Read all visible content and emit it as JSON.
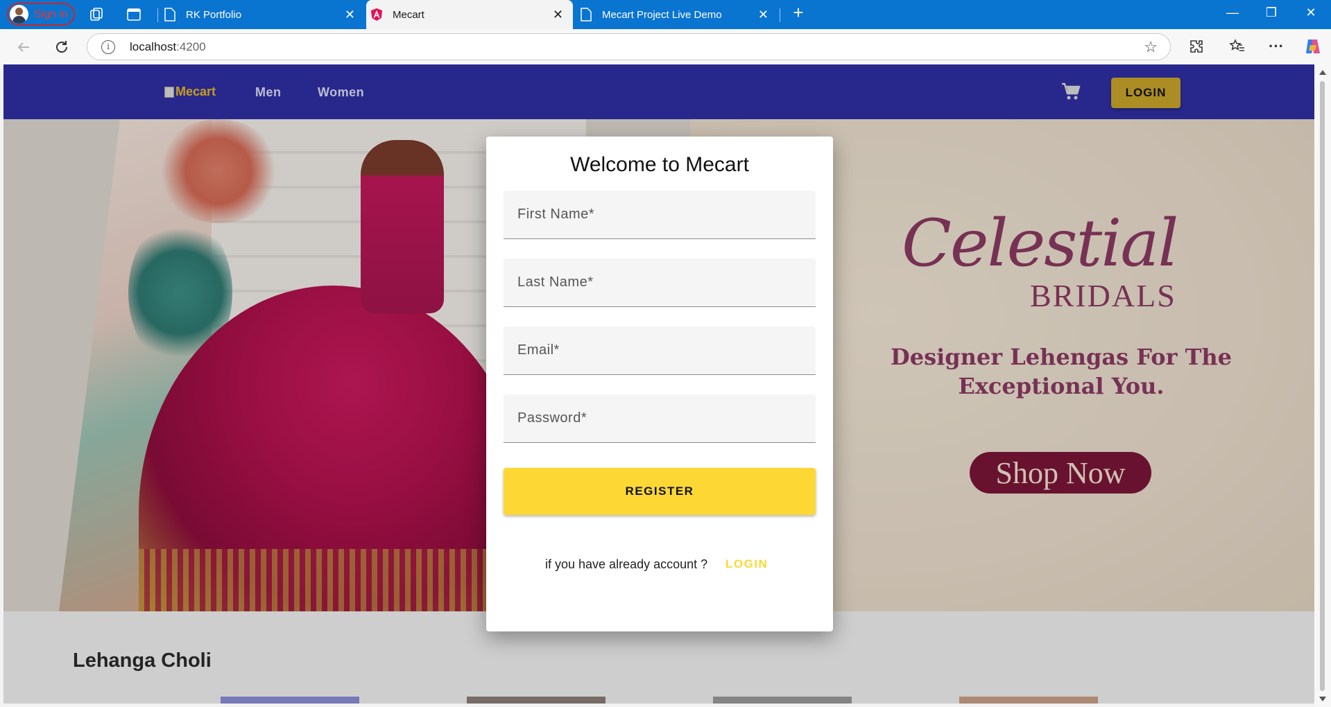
{
  "browser": {
    "signin_label": "Sign in",
    "tabs": [
      {
        "title": "RK Portfolio",
        "active": false
      },
      {
        "title": "Mecart",
        "active": true
      },
      {
        "title": "Mecart Project Live Demo",
        "active": false
      }
    ],
    "url_host": "localhost",
    "url_port": ":4200",
    "accent": "#0a74d1"
  },
  "navbar": {
    "logo_alt": "Mecart",
    "links": [
      "Men",
      "Women"
    ],
    "login_label": "LOGIN",
    "bg_color": "#2f2fa4"
  },
  "hero": {
    "title_script": "Celestial",
    "title_caps": "BRIDALS",
    "tagline": "Designer Lehengas For The Exceptional You.",
    "cta": "Shop Now"
  },
  "section": {
    "title": "Lehanga Choli"
  },
  "modal": {
    "title": "Welcome to Mecart",
    "fields": {
      "first_name": "First Name*",
      "last_name": "Last Name*",
      "email": "Email*",
      "password": "Password*"
    },
    "register_label": "REGISTER",
    "already_text": "if you have already account ?",
    "login_link": "LOGIN",
    "accent": "#fdd835"
  }
}
